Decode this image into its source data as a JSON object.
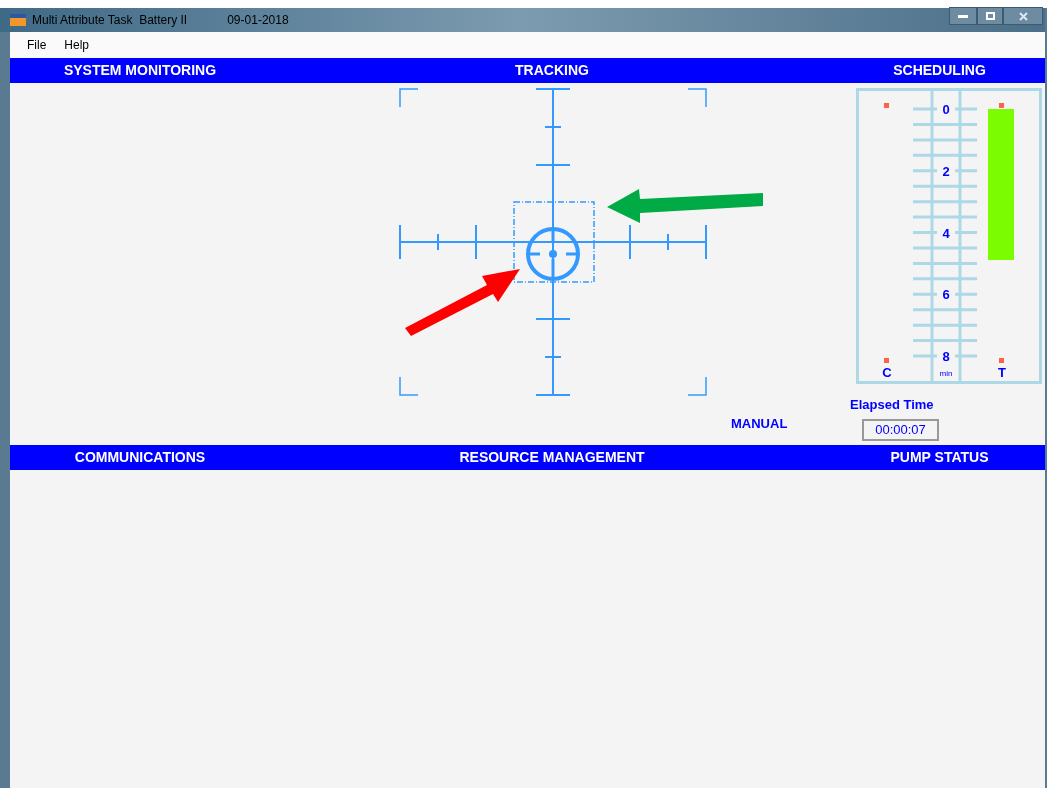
{
  "window": {
    "title": "Multi Attribute Task  Battery II",
    "date": "09-01-2018"
  },
  "menu": [
    "File",
    "Help"
  ],
  "top_panels": [
    "SYSTEM MONITORING",
    "TRACKING",
    "SCHEDULING"
  ],
  "tracking": {
    "mode": "MANUAL"
  },
  "scheduling": {
    "scale_labels": [
      "0",
      "2",
      "4",
      "6",
      "8"
    ],
    "unit": "min",
    "columns": [
      "C",
      "T"
    ]
  },
  "elapsed_time": {
    "label": "Elapsed Time",
    "value": "00:00:07"
  },
  "bottom_panels": [
    "COMMUNICATIONS",
    "RESOURCE MANAGEMENT",
    "PUMP STATUS"
  ]
}
